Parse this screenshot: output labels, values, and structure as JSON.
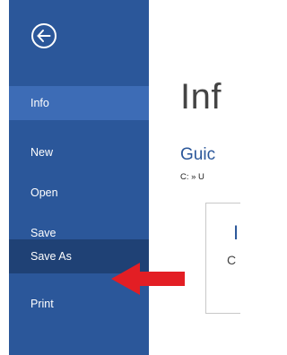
{
  "backstage": {
    "back_icon": "back-arrow-circle-icon",
    "nav_items": [
      {
        "label": "Info",
        "state": "selected"
      },
      {
        "label": "New",
        "state": "normal"
      },
      {
        "label": "Open",
        "state": "normal"
      },
      {
        "label": "Save",
        "state": "normal"
      },
      {
        "label": "Save As",
        "state": "hover"
      },
      {
        "label": "Print",
        "state": "normal"
      }
    ]
  },
  "content": {
    "title": "Inf",
    "document_name": "Guic",
    "document_path": "C: » U",
    "card_mark": "I",
    "card_text": "C"
  },
  "annotation": {
    "arrow_icon": "red-arrow-icon",
    "arrow_color": "#e31e24"
  },
  "colors": {
    "nav_background": "#2b579a",
    "nav_selected": "#3d6cb6",
    "nav_hover": "#1f4175",
    "accent_text": "#2b579a"
  }
}
